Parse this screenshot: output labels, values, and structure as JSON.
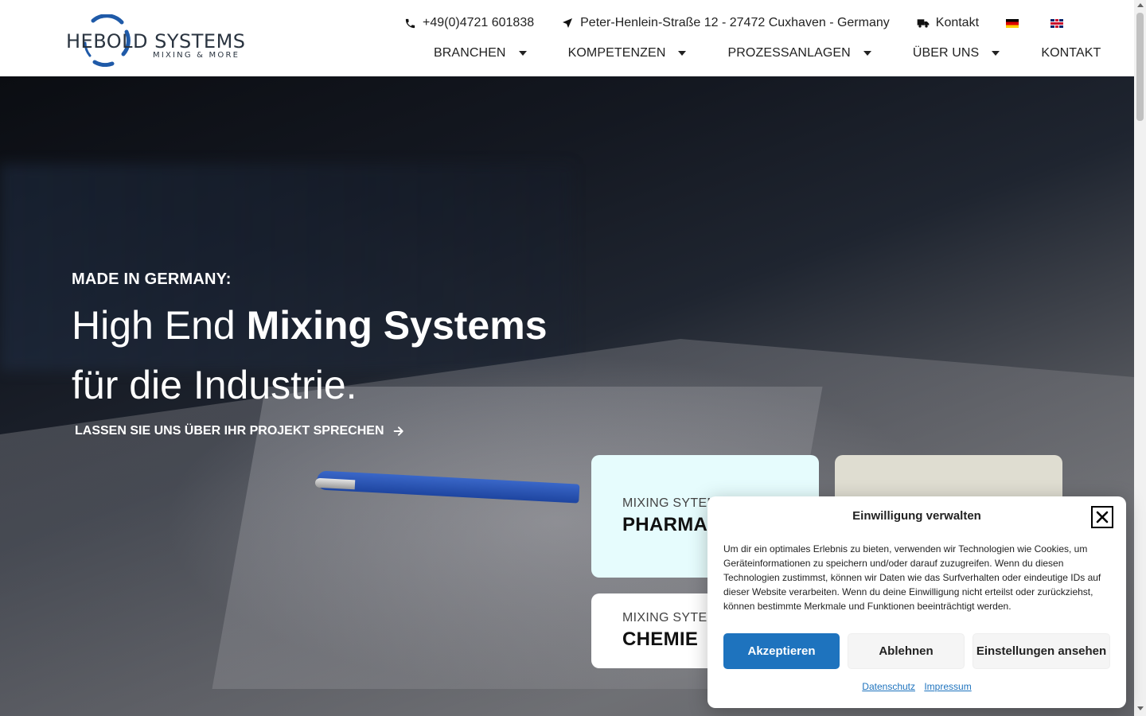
{
  "brand": {
    "name": "HEBOLD SYSTEMS",
    "tagline": "MIXING & MORE"
  },
  "topbar": {
    "phone": "+49(0)4721 601838",
    "address": "Peter-Henlein-Straße 12 - 27472 Cuxhaven - Germany",
    "contact": "Kontakt"
  },
  "nav": {
    "items": [
      {
        "label": "BRANCHEN"
      },
      {
        "label": "KOMPETENZEN"
      },
      {
        "label": "PROZESSANLAGEN"
      },
      {
        "label": "ÜBER UNS"
      },
      {
        "label": "KONTAKT"
      }
    ]
  },
  "hero": {
    "kicker": "MADE IN GERMANY:",
    "title_light": "High End ",
    "title_bold": "Mixing Systems",
    "title_line2": "für die Industrie.",
    "cta": "LASSEN SIE UNS ÜBER IHR PROJEKT SPRECHEN"
  },
  "cards": [
    {
      "kicker": "MIXING SYTEM",
      "title": "PHARMA"
    },
    {
      "kicker": "MIXING SYTEM",
      "title": "CHEMIE"
    }
  ],
  "consent": {
    "title": "Einwilligung verwalten",
    "text": "Um dir ein optimales Erlebnis zu bieten, verwenden wir Technologien wie Cookies, um Geräteinformationen zu speichern und/oder darauf zuzugreifen. Wenn du diesen Technologien zustimmst, können wir Daten wie das Surfverhalten oder eindeutige IDs auf dieser Website verarbeiten. Wenn du deine Einwilligung nicht erteilst oder zurückziehst, können bestimmte Merkmale und Funktionen beeinträchtigt werden.",
    "accept": "Akzeptieren",
    "deny": "Ablehnen",
    "settings": "Einstellungen ansehen",
    "link_privacy": "Datenschutz",
    "link_imprint": "Impressum"
  },
  "colors": {
    "accent": "#1e73be",
    "card_pharma": "#e6fcfd",
    "card_beige": "#dfddd1",
    "logo_blue": "#1f5aa8"
  },
  "icons": {
    "phone": "phone-icon",
    "address": "location-arrow-icon",
    "contact": "truck-contact-icon",
    "cta": "arrow-right-icon",
    "close": "close-icon"
  }
}
